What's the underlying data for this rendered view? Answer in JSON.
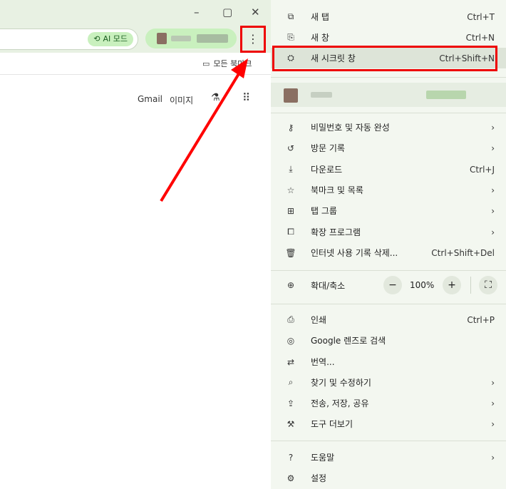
{
  "window": {
    "minimize": "–",
    "restore": "▢",
    "close": "✕"
  },
  "toolbar": {
    "ai_mode_label": "AI 모드",
    "ai_mode_icon": "search-sparkle-icon",
    "menu_icon": "⋮"
  },
  "bookmarks": {
    "folder_label": "모든 북마크",
    "folder_icon": "folder-icon"
  },
  "ntp": {
    "gmail": "Gmail",
    "images": "이미지",
    "labs_icon": "flask-icon",
    "apps_icon": "apps-grid-icon"
  },
  "menu": {
    "items_top": [
      {
        "icon": "⧉",
        "icon_name": "new-tab-icon",
        "label": "새 탭",
        "shortcut": "Ctrl+T"
      },
      {
        "icon": "⎘",
        "icon_name": "new-window-icon",
        "label": "새 창",
        "shortcut": "Ctrl+N"
      },
      {
        "icon": "⛭",
        "icon_name": "incognito-icon",
        "label": "새 시크릿 창",
        "shortcut": "Ctrl+Shift+N"
      }
    ],
    "items_mid": [
      {
        "icon": "⚷",
        "icon_name": "key-icon",
        "label": "비밀번호 및 자동 완성",
        "shortcut": "›"
      },
      {
        "icon": "↺",
        "icon_name": "history-icon",
        "label": "방문 기록",
        "shortcut": "›"
      },
      {
        "icon": "⤓",
        "icon_name": "download-icon",
        "label": "다운로드",
        "shortcut": "Ctrl+J"
      },
      {
        "icon": "☆",
        "icon_name": "bookmark-star-icon",
        "label": "북마크 및 목록",
        "shortcut": "›"
      },
      {
        "icon": "⊞",
        "icon_name": "tab-groups-icon",
        "label": "탭 그룹",
        "shortcut": "›"
      },
      {
        "icon": "⧠",
        "icon_name": "extension-icon",
        "label": "확장 프로그램",
        "shortcut": "›"
      },
      {
        "icon": "🗑",
        "icon_name": "trash-icon",
        "label": "인터넷 사용 기록 삭제...",
        "shortcut": "Ctrl+Shift+Del"
      }
    ],
    "zoom": {
      "icon": "⊕",
      "label": "확대/축소",
      "minus": "−",
      "value": "100%",
      "plus": "+",
      "fullscreen": "⛶"
    },
    "items_bot": [
      {
        "icon": "⎙",
        "icon_name": "print-icon",
        "label": "인쇄",
        "shortcut": "Ctrl+P"
      },
      {
        "icon": "◎",
        "icon_name": "google-lens-icon",
        "label": "Google 렌즈로 검색",
        "shortcut": ""
      },
      {
        "icon": "⇄",
        "icon_name": "translate-icon",
        "label": "번역...",
        "shortcut": ""
      },
      {
        "icon": "⌕",
        "icon_name": "find-edit-icon",
        "label": "찾기 및 수정하기",
        "shortcut": "›"
      },
      {
        "icon": "⇪",
        "icon_name": "cast-save-share-icon",
        "label": "전송, 저장, 공유",
        "shortcut": "›"
      },
      {
        "icon": "⚒",
        "icon_name": "toolbox-icon",
        "label": "도구 더보기",
        "shortcut": "›"
      }
    ],
    "items_end": [
      {
        "icon": "?",
        "icon_name": "help-icon",
        "label": "도움말",
        "shortcut": "›"
      },
      {
        "icon": "⚙",
        "icon_name": "settings-gear-icon",
        "label": "설정",
        "shortcut": ""
      }
    ]
  },
  "colors": {
    "highlight_red": "#e00000",
    "menu_bg": "#f3f7f0",
    "accent_green": "#c9f0be"
  }
}
